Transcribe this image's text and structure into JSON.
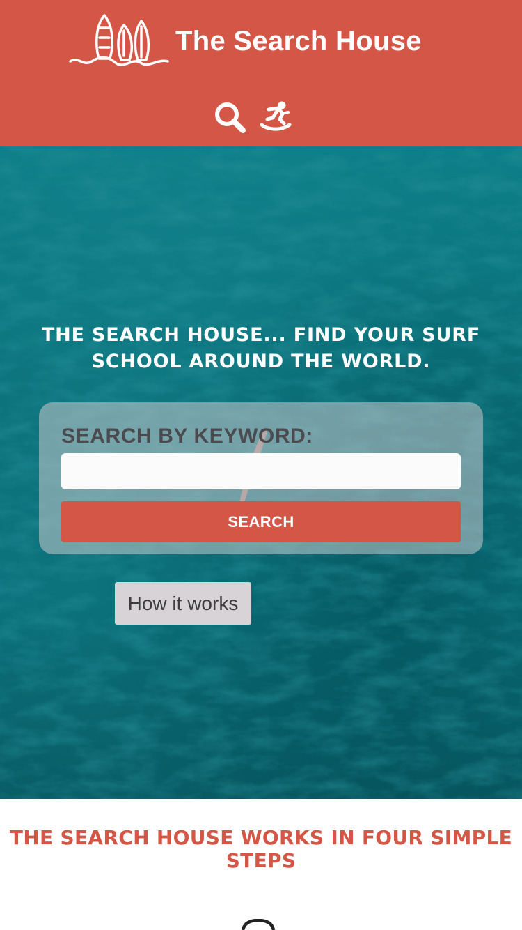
{
  "header": {
    "brand_title": "The Search House",
    "logo_icon": "surfboards-logo-icon",
    "nav": [
      {
        "icon": "search-icon"
      },
      {
        "icon": "snowboarder-icon"
      }
    ],
    "background_color": "#d35647"
  },
  "hero": {
    "heading": "THE SEARCH HOUSE... FIND YOUR SURF SCHOOL AROUND THE WORLD.",
    "search": {
      "label": "SEARCH BY KEYWORD:",
      "input_value": "",
      "placeholder": "",
      "button_label": "SEARCH"
    },
    "how_it_works_label": "How it works"
  },
  "steps": {
    "heading": "THE SEARCH HOUSE WORKS IN FOUR SIMPLE STEPS",
    "first_step_icon": "search-icon"
  },
  "colors": {
    "accent": "#d35647",
    "ocean": "#0b7781"
  }
}
